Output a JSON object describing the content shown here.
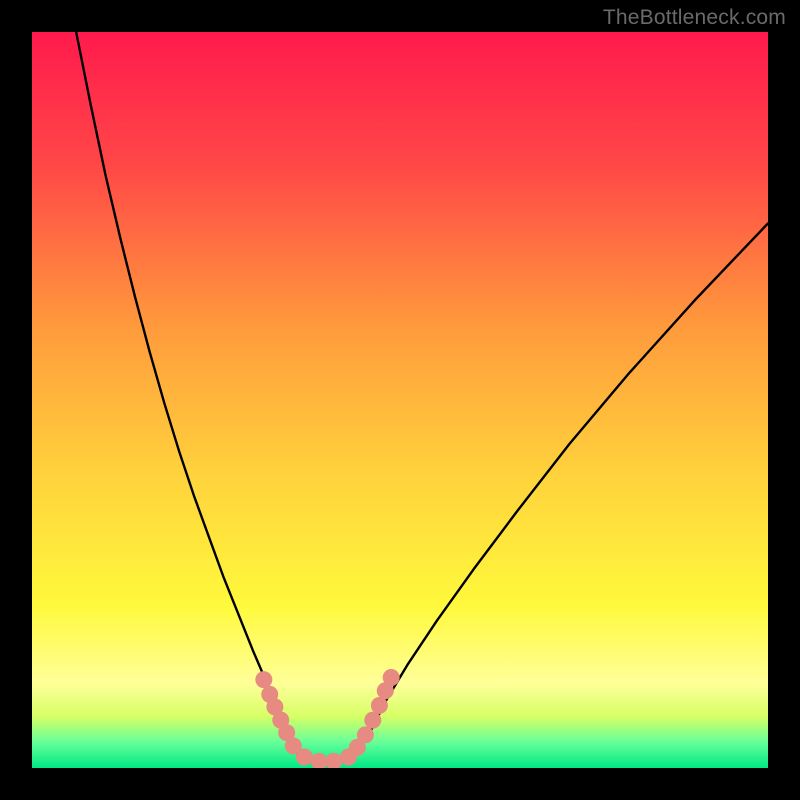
{
  "watermark": "TheBottleneck.com",
  "colors": {
    "frame": "#000000",
    "curve": "#000000",
    "marker": "#e78a82",
    "gradient_stops": [
      {
        "offset": 0.0,
        "color": "#ff1a4d"
      },
      {
        "offset": 0.18,
        "color": "#ff4747"
      },
      {
        "offset": 0.4,
        "color": "#ff9a3c"
      },
      {
        "offset": 0.6,
        "color": "#ffd23c"
      },
      {
        "offset": 0.78,
        "color": "#fff93c"
      },
      {
        "offset": 0.885,
        "color": "#ffff99"
      },
      {
        "offset": 0.93,
        "color": "#d6ff66"
      },
      {
        "offset": 0.965,
        "color": "#66ff99"
      },
      {
        "offset": 1.0,
        "color": "#00e884"
      }
    ]
  },
  "chart_data": {
    "type": "line",
    "title": "",
    "xlabel": "",
    "ylabel": "",
    "xlim": [
      0,
      100
    ],
    "ylim": [
      0,
      100
    ],
    "grid": false,
    "legend": false,
    "series": [
      {
        "name": "curve-left",
        "x": [
          6,
          8,
          10,
          12,
          14,
          16,
          18,
          20,
          22,
          24,
          26,
          28,
          30,
          31.5,
          33,
          34.5,
          36
        ],
        "y": [
          100,
          90,
          80.5,
          72,
          64,
          56.5,
          49.5,
          43,
          37,
          31.5,
          26,
          21,
          16,
          12.5,
          9,
          5.5,
          2
        ]
      },
      {
        "name": "valley-floor",
        "x": [
          36,
          38,
          40,
          42,
          44
        ],
        "y": [
          2,
          0.8,
          0.5,
          0.8,
          2
        ]
      },
      {
        "name": "curve-right",
        "x": [
          44,
          46,
          48,
          51,
          55,
          60,
          66,
          73,
          81,
          90,
          100
        ],
        "y": [
          2,
          5,
          9,
          14,
          20,
          27,
          35,
          44,
          53.5,
          63.5,
          74
        ]
      }
    ],
    "markers": {
      "name": "highlight-dots",
      "points": [
        {
          "x": 31.5,
          "y": 12.0
        },
        {
          "x": 32.3,
          "y": 10.0
        },
        {
          "x": 33.0,
          "y": 8.3
        },
        {
          "x": 33.8,
          "y": 6.5
        },
        {
          "x": 34.6,
          "y": 4.8
        },
        {
          "x": 35.5,
          "y": 3.0
        },
        {
          "x": 37.0,
          "y": 1.5
        },
        {
          "x": 39.0,
          "y": 0.9
        },
        {
          "x": 41.0,
          "y": 0.9
        },
        {
          "x": 43.0,
          "y": 1.5
        },
        {
          "x": 44.2,
          "y": 2.8
        },
        {
          "x": 45.3,
          "y": 4.5
        },
        {
          "x": 46.3,
          "y": 6.5
        },
        {
          "x": 47.2,
          "y": 8.5
        },
        {
          "x": 48.0,
          "y": 10.5
        },
        {
          "x": 48.8,
          "y": 12.3
        }
      ]
    }
  }
}
